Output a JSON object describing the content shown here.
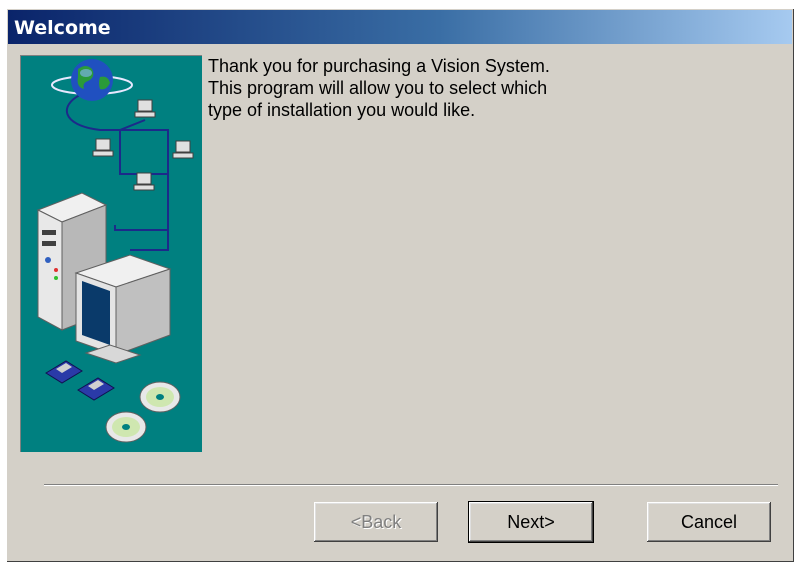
{
  "window": {
    "title": "Welcome"
  },
  "message": {
    "lines": [
      "Thank you for purchasing a Vision System.",
      "This program will allow you to select which",
      "type of installation you would like."
    ]
  },
  "buttons": {
    "back_label": "<Back",
    "next_label": "Next>",
    "cancel_label": "Cancel"
  },
  "colors": {
    "title_bar_start": "#0a246a",
    "title_bar_end": "#a6caf0",
    "illustration_bg": "#008080",
    "dialog_face": "#d4d0c8"
  },
  "illustration": {
    "items": [
      "globe-icon",
      "network-computer-icon",
      "tower-pc-icon",
      "monitor-icon",
      "floppy-disk-icon",
      "cd-icon"
    ]
  }
}
